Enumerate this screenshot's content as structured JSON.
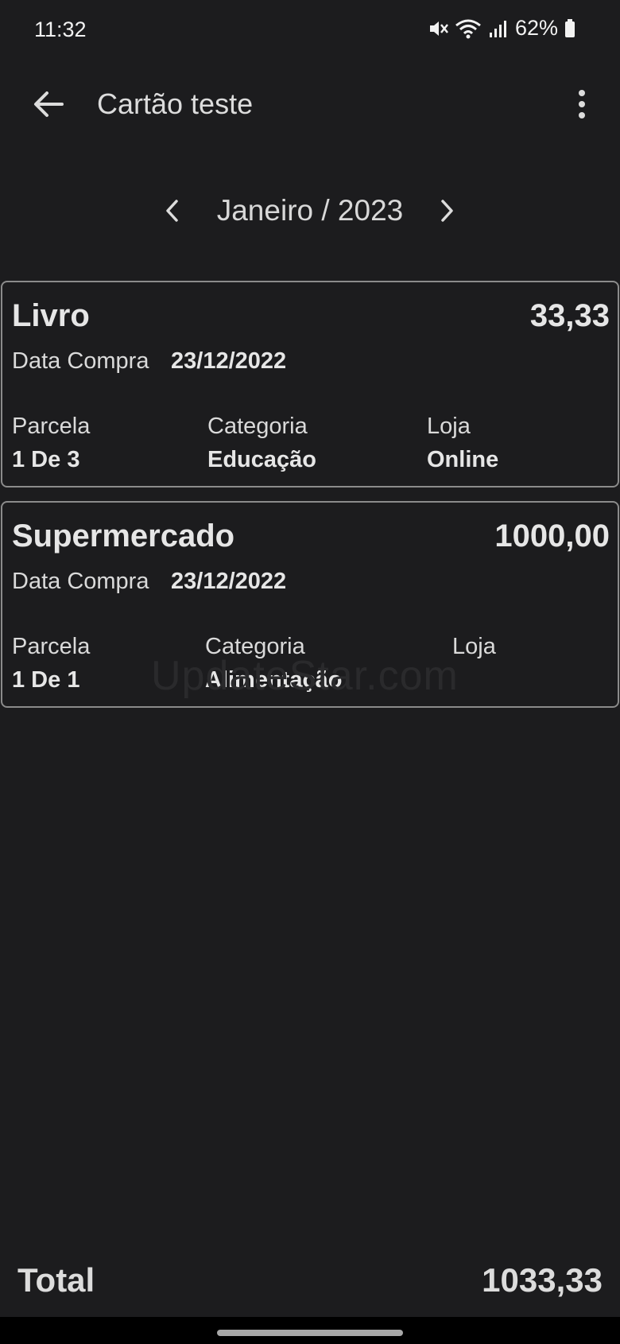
{
  "status_bar": {
    "time": "11:32",
    "battery": "62%",
    "icons": [
      "mute-icon",
      "wifi-icon",
      "signal-icon",
      "battery-icon"
    ]
  },
  "app_bar": {
    "title": "Cartão teste",
    "back_icon": "arrow-back-icon",
    "menu_icon": "more-vertical-icon"
  },
  "month_nav": {
    "label": "Janeiro / 2023",
    "prev_icon": "chevron-left-icon",
    "next_icon": "chevron-right-icon"
  },
  "purchases": [
    {
      "title": "Livro",
      "amount": "33,33",
      "date_label": "Data Compra",
      "date": "23/12/2022",
      "installment_label": "Parcela",
      "installment": "1 De 3",
      "category_label": "Categoria",
      "category": "Educação",
      "store_label": "Loja",
      "store": "Online"
    },
    {
      "title": "Supermercado",
      "amount": "1000,00",
      "date_label": "Data Compra",
      "date": "23/12/2022",
      "installment_label": "Parcela",
      "installment": "1 De 1",
      "category_label": "Categoria",
      "category": "Alimentação",
      "store_label": "Loja",
      "store": ""
    }
  ],
  "watermark": "UpdateStar.com",
  "footer": {
    "total_label": "Total",
    "total_value": "1033,33"
  },
  "colors": {
    "background": "#1c1c1e",
    "card_border": "#8b8b8b",
    "text": "#e3e3e3"
  }
}
